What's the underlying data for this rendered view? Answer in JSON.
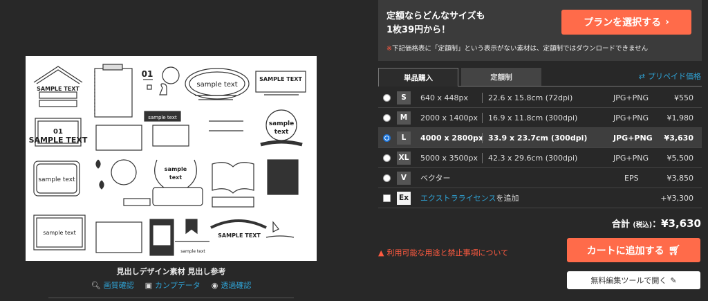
{
  "preview": {
    "texts": {
      "a": "SAMPLE TEXT",
      "b": "sample text",
      "c": "01",
      "d": "sample",
      "e": "text"
    },
    "caption": "見出しデザイン素材 見出し参考",
    "actions": [
      {
        "label": "画質確認",
        "icon": "zoom-icon"
      },
      {
        "label": "カンプデータ",
        "icon": "image-icon"
      },
      {
        "label": "透過確認",
        "icon": "eye-icon"
      }
    ]
  },
  "promo": {
    "line1": "定額ならどんなサイズも",
    "line2": "1枚39円から！",
    "plan_button": "プランを選択する",
    "notice_mark": "※",
    "notice": "下記価格表に「定額制」という表示がない素材は、定額制ではダウンロードできません"
  },
  "tabs": {
    "single": "単品購入",
    "subscription": "定額制",
    "prepaid": "プリペイド価格"
  },
  "sizes": [
    {
      "code": "S",
      "px": "640 x 448px",
      "cm": "22.6 x 15.8cm (72dpi)",
      "format": "JPG+PNG",
      "price": "¥550",
      "selected": false
    },
    {
      "code": "M",
      "px": "2000 x 1400px",
      "cm": "16.9 x 11.8cm (300dpi)",
      "format": "JPG+PNG",
      "price": "¥1,980",
      "selected": false
    },
    {
      "code": "L",
      "px": "4000 x 2800px",
      "cm": "33.9 x 23.7cm (300dpi)",
      "format": "JPG+PNG",
      "price": "¥3,630",
      "selected": true
    },
    {
      "code": "XL",
      "px": "5000 x 3500px",
      "cm": "42.3 x 29.6cm (300dpi)",
      "format": "JPG+PNG",
      "price": "¥5,500",
      "selected": false
    }
  ],
  "vector": {
    "code": "V",
    "label": "ベクター",
    "format": "EPS",
    "price": "¥3,850"
  },
  "extra": {
    "code": "Ex",
    "link": "エクストラライセンス",
    "suffix": "を追加",
    "price": "+¥3,300"
  },
  "total": {
    "label": "合計",
    "tax": "(税込)",
    "colon": "：",
    "amount": "¥3,630"
  },
  "restrict": "利用可能な用途と禁止事項について",
  "cart_button": "カートに追加する",
  "edit_button": "無料編集ツールで開く"
}
